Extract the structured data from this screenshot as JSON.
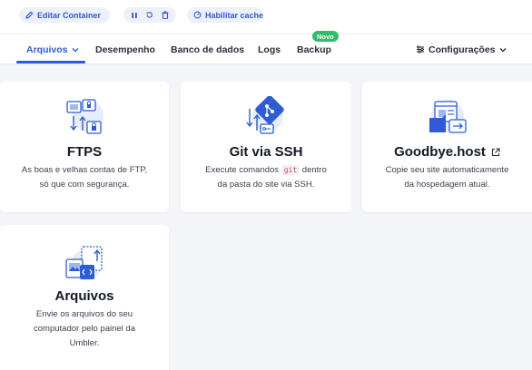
{
  "toolbar": {
    "edit_container": "Editar Container",
    "enable_cache": "Habilitar cache",
    "controls": [
      "pause",
      "restart",
      "delete"
    ]
  },
  "nav": {
    "tabs": [
      {
        "label": "Arquivos",
        "active": true,
        "dropdown": true
      },
      {
        "label": "Desempenho"
      },
      {
        "label": "Banco de dados"
      },
      {
        "label": "Logs"
      },
      {
        "label": "Backup",
        "badge": "Novo"
      }
    ],
    "settings_label": "Configurações"
  },
  "cards": [
    {
      "title": "FTPS",
      "desc_lines": [
        "As boas e velhas contas de FTP,",
        "só que com segurança."
      ],
      "icon": "ftps-illustration"
    },
    {
      "title": "Git via SSH",
      "desc_before": "Execute comandos",
      "code": "git",
      "desc_after": "dentro",
      "desc_line2": "da pasta do site via SSH.",
      "icon": "git-illustration"
    },
    {
      "title": "Goodbye.host",
      "desc_lines": [
        "Copie seu site automaticamente",
        "da hospedagem atual."
      ],
      "icon": "goodbye-host-illustration",
      "external": true
    },
    {
      "title": "Arquivos",
      "desc_lines": [
        "Envie os arquivos do seu",
        "computador pelo painel da",
        "Umbler."
      ],
      "icon": "files-illustration"
    }
  ],
  "colors": {
    "accent": "#2f5bd3",
    "badge": "#2ebd6b",
    "code": "#d23f5a"
  }
}
